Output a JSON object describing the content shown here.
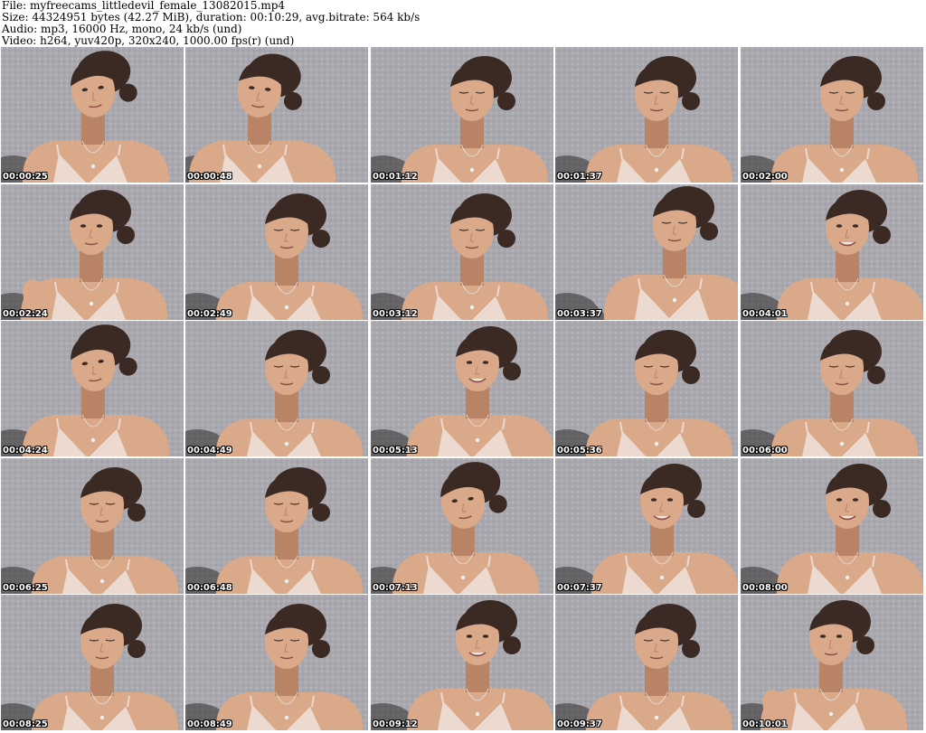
{
  "header": {
    "lines": [
      "File: myfreecams_littledevil_female_13082015.mp4",
      "Size: 44324951 bytes (42.27 MiB), duration: 00:10:29, avg.bitrate: 564 kb/s",
      "Audio: mp3, 16000 Hz, mono, 24 kb/s (und)",
      "Video: h264, yuv420p, 320x240, 1000.00 fps(r) (und)"
    ]
  },
  "grid": {
    "columns": 5,
    "rows": 5,
    "thumbnails": [
      {
        "timestamp": "00:00:25",
        "pose": "tilt-left"
      },
      {
        "timestamp": "00:00:48",
        "pose": "turn-right"
      },
      {
        "timestamp": "00:01:12",
        "pose": "look-down"
      },
      {
        "timestamp": "00:01:37",
        "pose": "look-down"
      },
      {
        "timestamp": "00:02:00",
        "pose": "look-down"
      },
      {
        "timestamp": "00:02:24",
        "pose": "hand-up"
      },
      {
        "timestamp": "00:02:49",
        "pose": "look-down"
      },
      {
        "timestamp": "00:03:12",
        "pose": "look-down"
      },
      {
        "timestamp": "00:03:37",
        "pose": "eyes-closed"
      },
      {
        "timestamp": "00:04:01",
        "pose": "smile"
      },
      {
        "timestamp": "00:04:24",
        "pose": "tilt-left"
      },
      {
        "timestamp": "00:04:49",
        "pose": "look-down"
      },
      {
        "timestamp": "00:05:13",
        "pose": "smile"
      },
      {
        "timestamp": "00:05:36",
        "pose": "look-down"
      },
      {
        "timestamp": "00:06:00",
        "pose": "look-down"
      },
      {
        "timestamp": "00:06:25",
        "pose": "look-down"
      },
      {
        "timestamp": "00:06:48",
        "pose": "look-down"
      },
      {
        "timestamp": "00:07:13",
        "pose": "tilt-left"
      },
      {
        "timestamp": "00:07:37",
        "pose": "smile"
      },
      {
        "timestamp": "00:08:00",
        "pose": "smile"
      },
      {
        "timestamp": "00:08:25",
        "pose": "look-down"
      },
      {
        "timestamp": "00:08:49",
        "pose": "look-down"
      },
      {
        "timestamp": "00:09:12",
        "pose": "smile"
      },
      {
        "timestamp": "00:09:37",
        "pose": "look-down"
      },
      {
        "timestamp": "00:10:01",
        "pose": "hand-up"
      }
    ]
  },
  "colors": {
    "wall": "#a9a8ae",
    "skin": "#d9a98a",
    "skin_shadow": "#b98466",
    "hair": "#3b2a24",
    "top": "#ecd9cf",
    "timestamp_text": "#ffffff"
  }
}
